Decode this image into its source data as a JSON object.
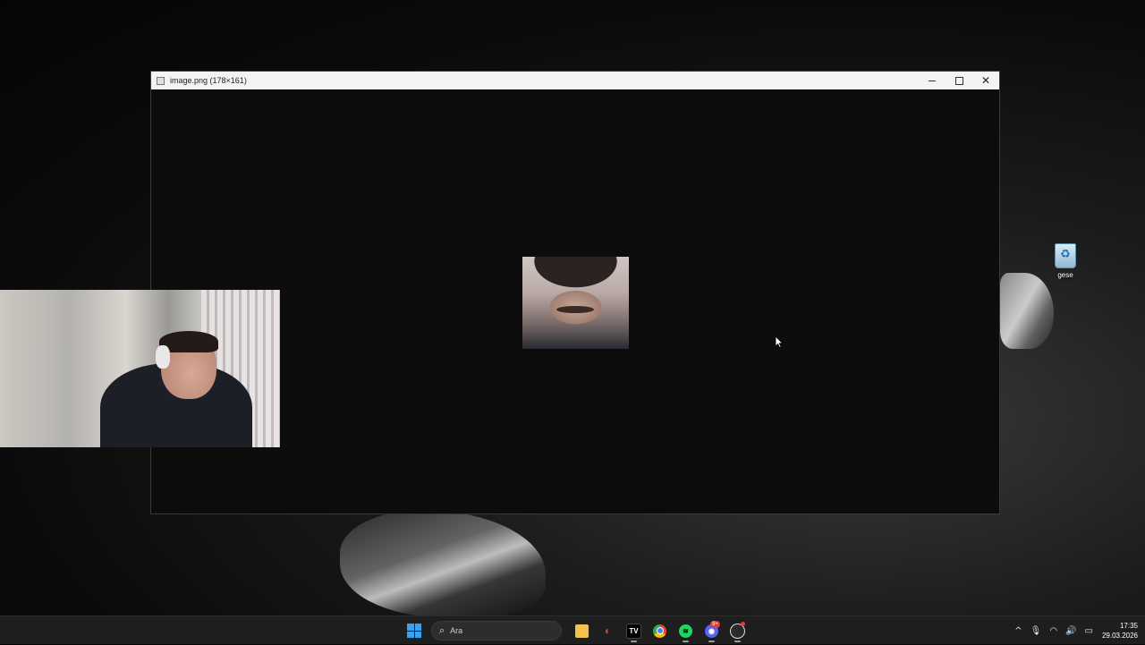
{
  "window": {
    "title": "image.png (178×161)",
    "controls": {
      "minimize": "minimize",
      "maximize": "maximize",
      "close": "✕"
    }
  },
  "desktop": {
    "icons": [
      {
        "label": "gese",
        "icon": "recycle-bin-icon"
      }
    ]
  },
  "taskbar": {
    "search_placeholder": "Ara",
    "search_icon": "⌕",
    "apps": [
      {
        "name": "file-explorer",
        "icon": "folder-icon"
      },
      {
        "name": "red-app",
        "icon": "red-logo-icon"
      },
      {
        "name": "tradingview",
        "icon": "tradingview-icon",
        "glyph": "TV"
      },
      {
        "name": "chrome",
        "icon": "chrome-icon"
      },
      {
        "name": "spotify",
        "icon": "spotify-icon"
      },
      {
        "name": "discord",
        "icon": "discord-icon",
        "badge": "9+"
      },
      {
        "name": "obs",
        "icon": "obs-icon"
      }
    ],
    "tray": {
      "chevron": "^",
      "time": "17:35",
      "date": "29.03.2026"
    }
  }
}
